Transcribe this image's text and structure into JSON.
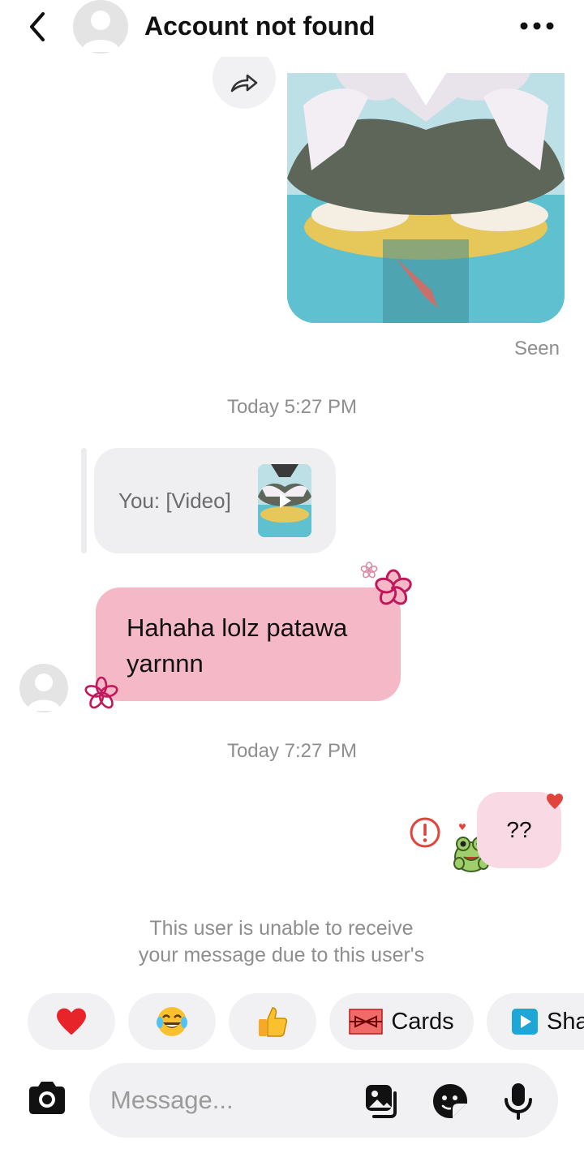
{
  "header": {
    "title": "Account not found",
    "back_icon": "chevron-left-icon",
    "more_icon": "more-horizontal-icon"
  },
  "thread": {
    "seen_label": "Seen",
    "timestamps": [
      "Today 5:27 PM",
      "Today 7:27 PM"
    ],
    "reply_preview": "You: [Video]",
    "incoming_message": "Hahaha lolz patawa yarnnn",
    "outgoing_message": "??",
    "unable_notice_line1": "This user is unable to receive",
    "unable_notice_line2": "your message due to this user's"
  },
  "quick_replies": [
    {
      "icon": "red-heart-emoji",
      "label": ""
    },
    {
      "icon": "tears-of-joy-emoji",
      "label": ""
    },
    {
      "icon": "thumbs-up-emoji",
      "label": ""
    },
    {
      "icon": "gift-card-icon",
      "label": "Cards"
    },
    {
      "icon": "play-share-icon",
      "label": "Sha"
    }
  ],
  "composer": {
    "placeholder": "Message...",
    "icons": [
      "camera-icon",
      "gallery-icon",
      "sticker-icon",
      "microphone-icon"
    ]
  },
  "colors": {
    "incoming_bubble": "#f4b8c7",
    "outgoing_bubble": "#f9d9e4",
    "error": "#e0443a",
    "flower": "#c2185b"
  }
}
